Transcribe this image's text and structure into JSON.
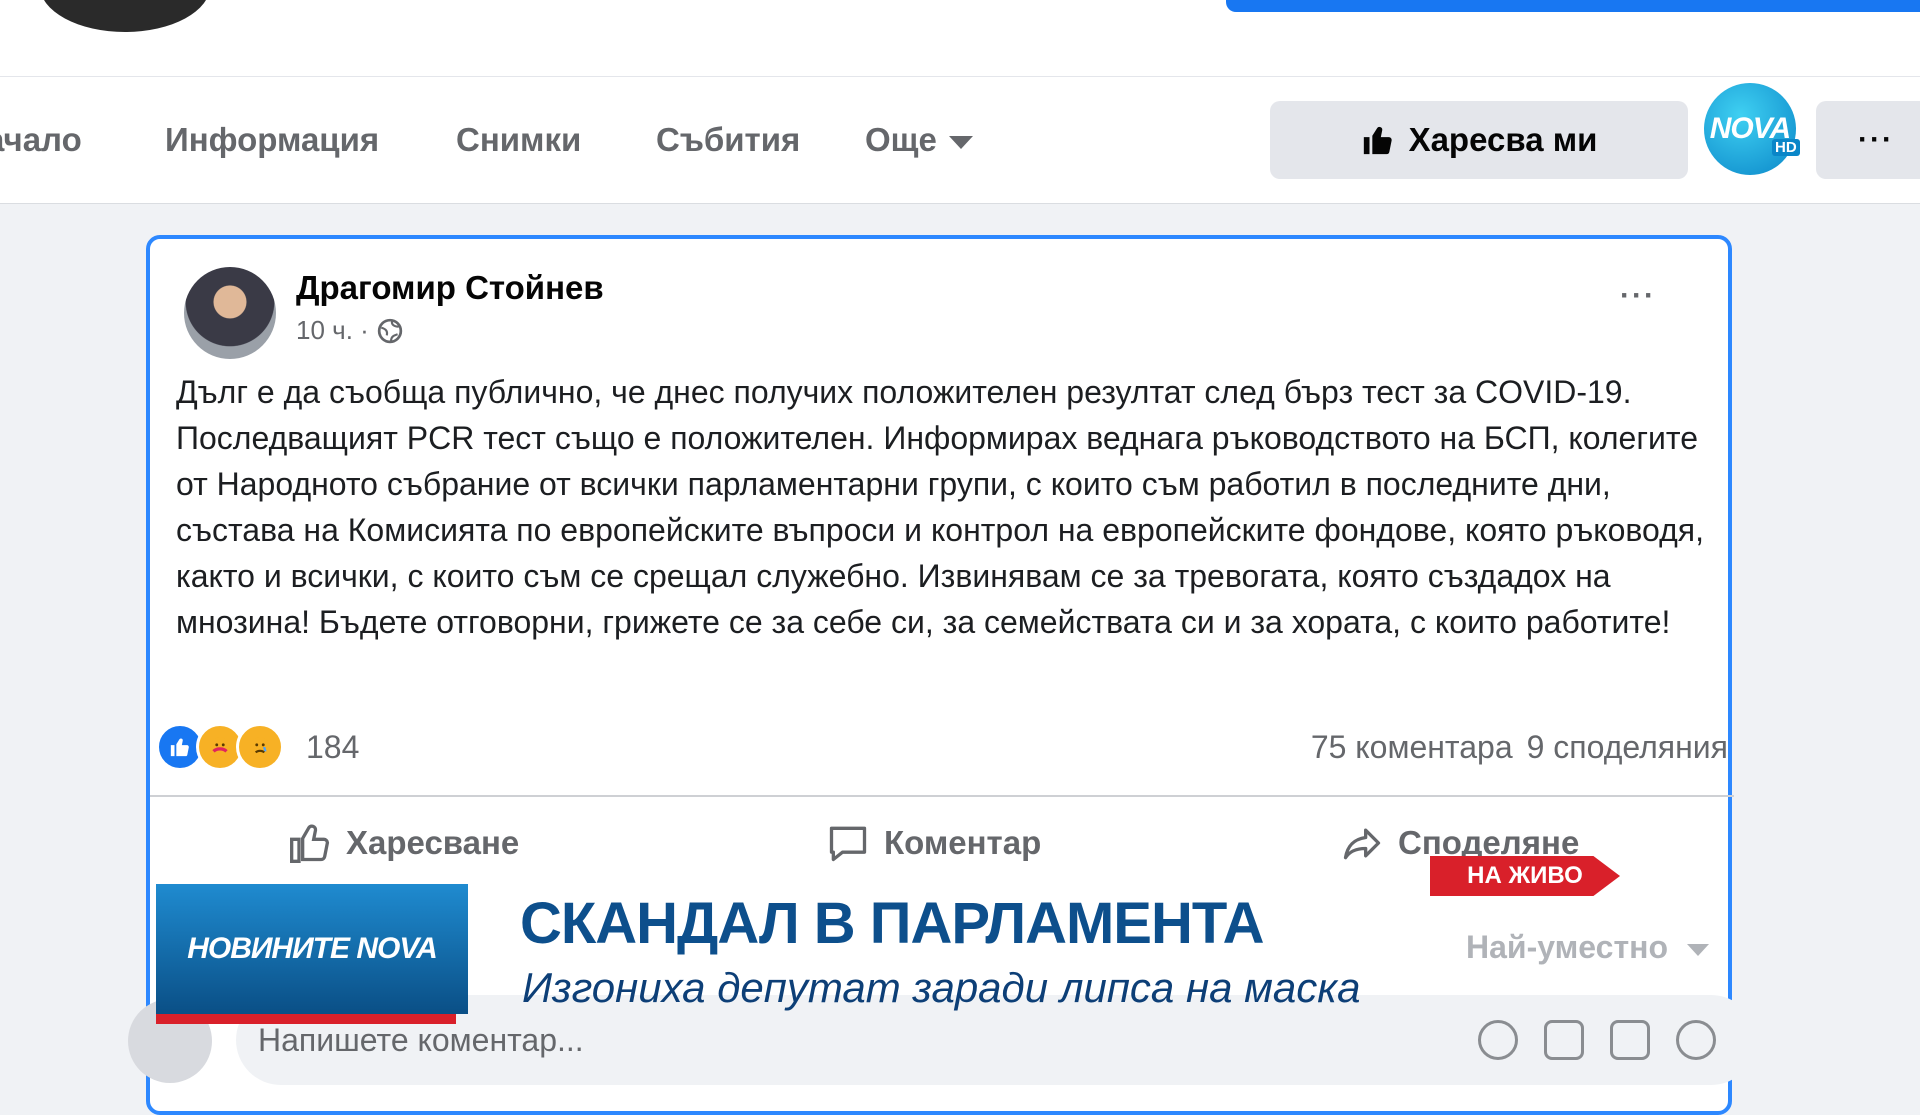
{
  "nav": {
    "tabs": [
      "ачало",
      "Информация",
      "Снимки",
      "Събития",
      "Още"
    ],
    "like_page_label": "Харесва ми",
    "more_label": "···"
  },
  "channel_logo": {
    "text": "NOVA",
    "badge": "HD"
  },
  "post": {
    "author": "Драгомир Стойнев",
    "time": "10 ч. ·",
    "options_label": "···",
    "text": "Дълг е да съобща публично, че днес получих положителен резултат след бърз тест за COVID-19. Последващият PCR тест също е положителен. Информирах веднага ръководството на БСП, колегите от Народното събрание от всички парламентарни групи, с които съм работил в последните дни, състава на Комисията по европейските въпроси и контрол на европейските фондове, която ръководя, както и всички, с които съм се срещал служебно. Извинявам се за тревогата, която създадох на мнозина! Бъдете отговорни, грижете се за себе си, за семействата си и за хората, с които работите!",
    "reaction_count": "184",
    "comments_count": "75 коментара",
    "shares_count": "9 споделяния",
    "actions": {
      "like": "Харесване",
      "comment": "Коментар",
      "share": "Споделяне"
    },
    "sort_label": "Най-уместно",
    "comment_placeholder": "Напишете коментар..."
  },
  "broadcast": {
    "logo_text": "НОВИНИТЕ NOVA",
    "live_label": "НА ЖИВО",
    "headline": "СКАНДАЛ В ПАРЛАМЕНТА",
    "subheadline": "Изгониха депутат заради липса на маска"
  },
  "colors": {
    "accent": "#1877f2",
    "live_red": "#d9202a",
    "headline_blue": "#0d4f8c"
  }
}
